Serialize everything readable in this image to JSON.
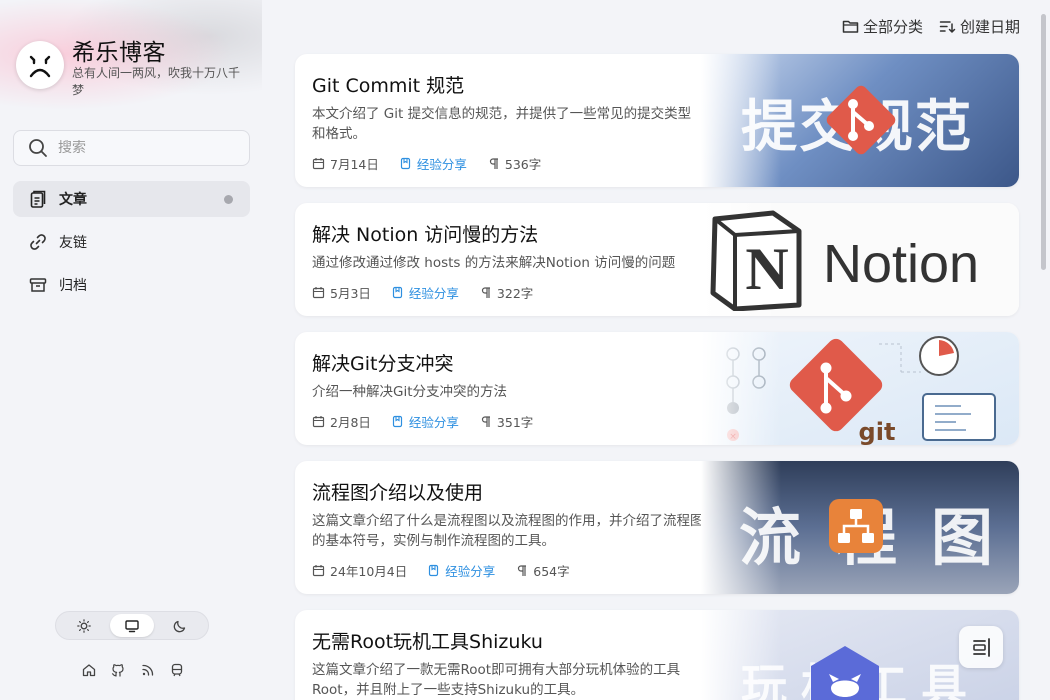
{
  "site": {
    "title": "希乐博客",
    "description": "总有人间一两风，吹我十万八千梦"
  },
  "search": {
    "placeholder": "搜索"
  },
  "nav": [
    {
      "label": "文章",
      "icon": "article-icon",
      "active": true
    },
    {
      "label": "友链",
      "icon": "link-icon",
      "active": false
    },
    {
      "label": "归档",
      "icon": "archive-icon",
      "active": false
    }
  ],
  "topbar": {
    "category_label": "全部分类",
    "sort_label": "创建日期"
  },
  "posts": [
    {
      "title": "Git Commit 规范",
      "excerpt": "本文介绍了 Git 提交信息的规范，并提供了一些常见的提交类型和格式。",
      "date": "7月14日",
      "category": "经验分享",
      "words": "536字",
      "cover_text": "提交规范"
    },
    {
      "title": "解决 Notion 访问慢的方法",
      "excerpt": "通过修改通过修改 hosts 的方法来解决Notion 访问慢的问题",
      "date": "5月3日",
      "category": "经验分享",
      "words": "322字",
      "cover_text": "Notion"
    },
    {
      "title": "解决Git分支冲突",
      "excerpt": "介绍一种解决Git分支冲突的方法",
      "date": "2月8日",
      "category": "经验分享",
      "words": "351字",
      "cover_text": "git"
    },
    {
      "title": "流程图介绍以及使用",
      "excerpt": "这篇文章介绍了什么是流程图以及流程图的作用，并介绍了流程图的基本符号，实例与制作流程图的工具。",
      "date": "24年10月4日",
      "category": "经验分享",
      "words": "654字",
      "cover_text": "流程图"
    },
    {
      "title": "无需Root玩机工具Shizuku",
      "excerpt": "这篇文章介绍了一款无需Root即可拥有大部分玩机体验的工具Root，并且附上了一些支持Shizuku的工具。",
      "cover_text": "玩机工具"
    }
  ],
  "colors": {
    "accent": "#2d8fe0",
    "background": "#f3f4f8",
    "git_red": "#e05a4a",
    "flow_orange": "#e8833a"
  },
  "footer_icons": [
    "home-icon",
    "github-icon",
    "rss-icon",
    "subway-icon"
  ],
  "theme_options": [
    "light",
    "system",
    "dark"
  ],
  "theme_selected": "system"
}
